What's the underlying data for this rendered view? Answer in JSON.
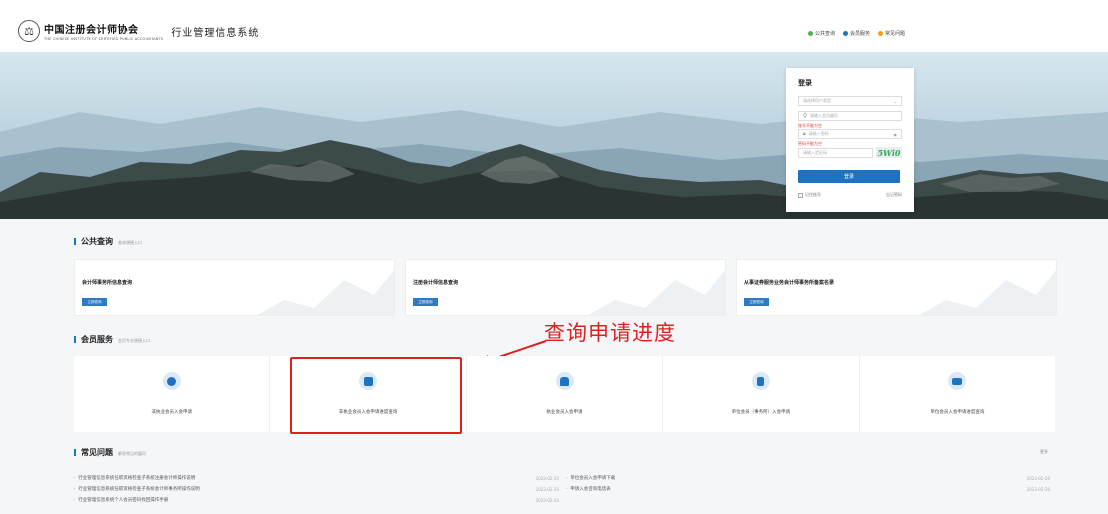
{
  "header": {
    "logo_cn": "中国注册会计师协会",
    "logo_en": "THE CHINESE INSTITUTE OF CERTIFIED PUBLIC ACCOUNTANTS",
    "system_title": "行业管理信息系统",
    "links": [
      {
        "label": "公共查询",
        "color": "#4caf50"
      },
      {
        "label": "会员服务",
        "color": "#1e72c2"
      },
      {
        "label": "常见问题",
        "color": "#f59e0b"
      }
    ]
  },
  "login": {
    "title": "登录",
    "user_type_placeholder": "请选择用户类型",
    "member_no_placeholder": "请输入会员编号",
    "member_no_error": "账号不能为空",
    "password_placeholder": "请输入密码",
    "password_error": "密码不能为空",
    "captcha_placeholder": "请输入验证码",
    "captcha_text": "5Wi0",
    "login_button": "登录",
    "remember": "记住账号",
    "forgot": "忘记密码"
  },
  "public_query": {
    "title": "公共查询",
    "subtitle": "查询便捷入口",
    "cards": [
      {
        "title": "会计师事务所信息查询",
        "button": "立即查询"
      },
      {
        "title": "注册会计师信息查询",
        "button": "立即查询"
      },
      {
        "title": "从事证券服务业务会计师事务所备案名录",
        "button": "立即查询"
      }
    ]
  },
  "member_service": {
    "title": "会员服务",
    "subtitle": "会员专业便捷入口",
    "items": [
      {
        "label": "非执业会员入会申请"
      },
      {
        "label": "非执业会员入会申请进度查询"
      },
      {
        "label": "执业会员入会申请"
      },
      {
        "label": "单位会员（事务所）入会申请"
      },
      {
        "label": "单位会员入会申请进度查询"
      }
    ]
  },
  "annotation": "查询申请进度",
  "faq": {
    "title": "常见问题",
    "subtitle": "解答常见的疑问",
    "more": "更多",
    "left": [
      {
        "text": "行业管理信息系统任职资格检查子系统注册会计师操作说明",
        "date": "2023-02-20"
      },
      {
        "text": "行业管理信息系统任职资格检查子系统会计师事务所操作说明",
        "date": "2023-02-20"
      },
      {
        "text": "行业管理信息系统个人会员密码找回操作手册",
        "date": "2023-02-20"
      }
    ],
    "right": [
      {
        "text": "单位会员入会申请下载",
        "date": "2023-02-20"
      },
      {
        "text": "申请入会咨询电话表",
        "date": "2023-02-20"
      }
    ]
  }
}
